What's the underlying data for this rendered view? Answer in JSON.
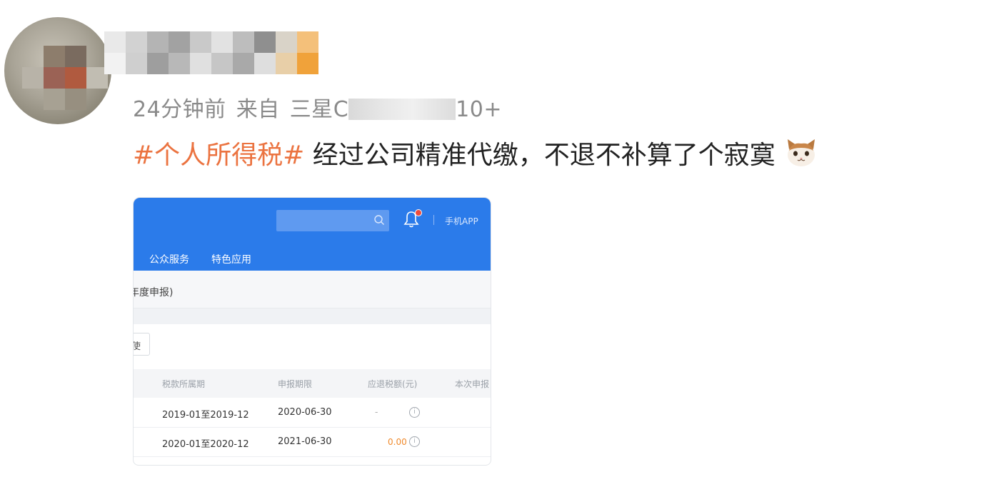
{
  "post": {
    "meta": {
      "time": "24分钟前",
      "source_prefix": "来自",
      "device_visible_start": "三星",
      "device_visible_start_letter": "C",
      "device_visible_end": "10+"
    },
    "hashtag": "#个人所得税#",
    "text": "经过公司精准代缴，不退不补算了个寂寞",
    "emoji": "cat-face"
  },
  "screenshot": {
    "header": {
      "search_placeholder": "",
      "app_link": "手机APP",
      "nav": [
        "公众服务",
        "特色应用"
      ]
    },
    "subtitle": "年度申报)",
    "small_button": "使",
    "table": {
      "headers": [
        "税款所属期",
        "申报期限",
        "应退税额(元)",
        "本次申报"
      ],
      "rows": [
        {
          "period": "2019-01至2019-12",
          "deadline": "2020-06-30",
          "amount": "-"
        },
        {
          "period": "2020-01至2020-12",
          "deadline": "2021-06-30",
          "amount": "0.00"
        }
      ]
    }
  },
  "colors": {
    "hashtag": "#eb7340",
    "header_blue": "#2b7bea",
    "amount_orange": "#f08a2c",
    "meta_gray": "#8a8a8a"
  }
}
